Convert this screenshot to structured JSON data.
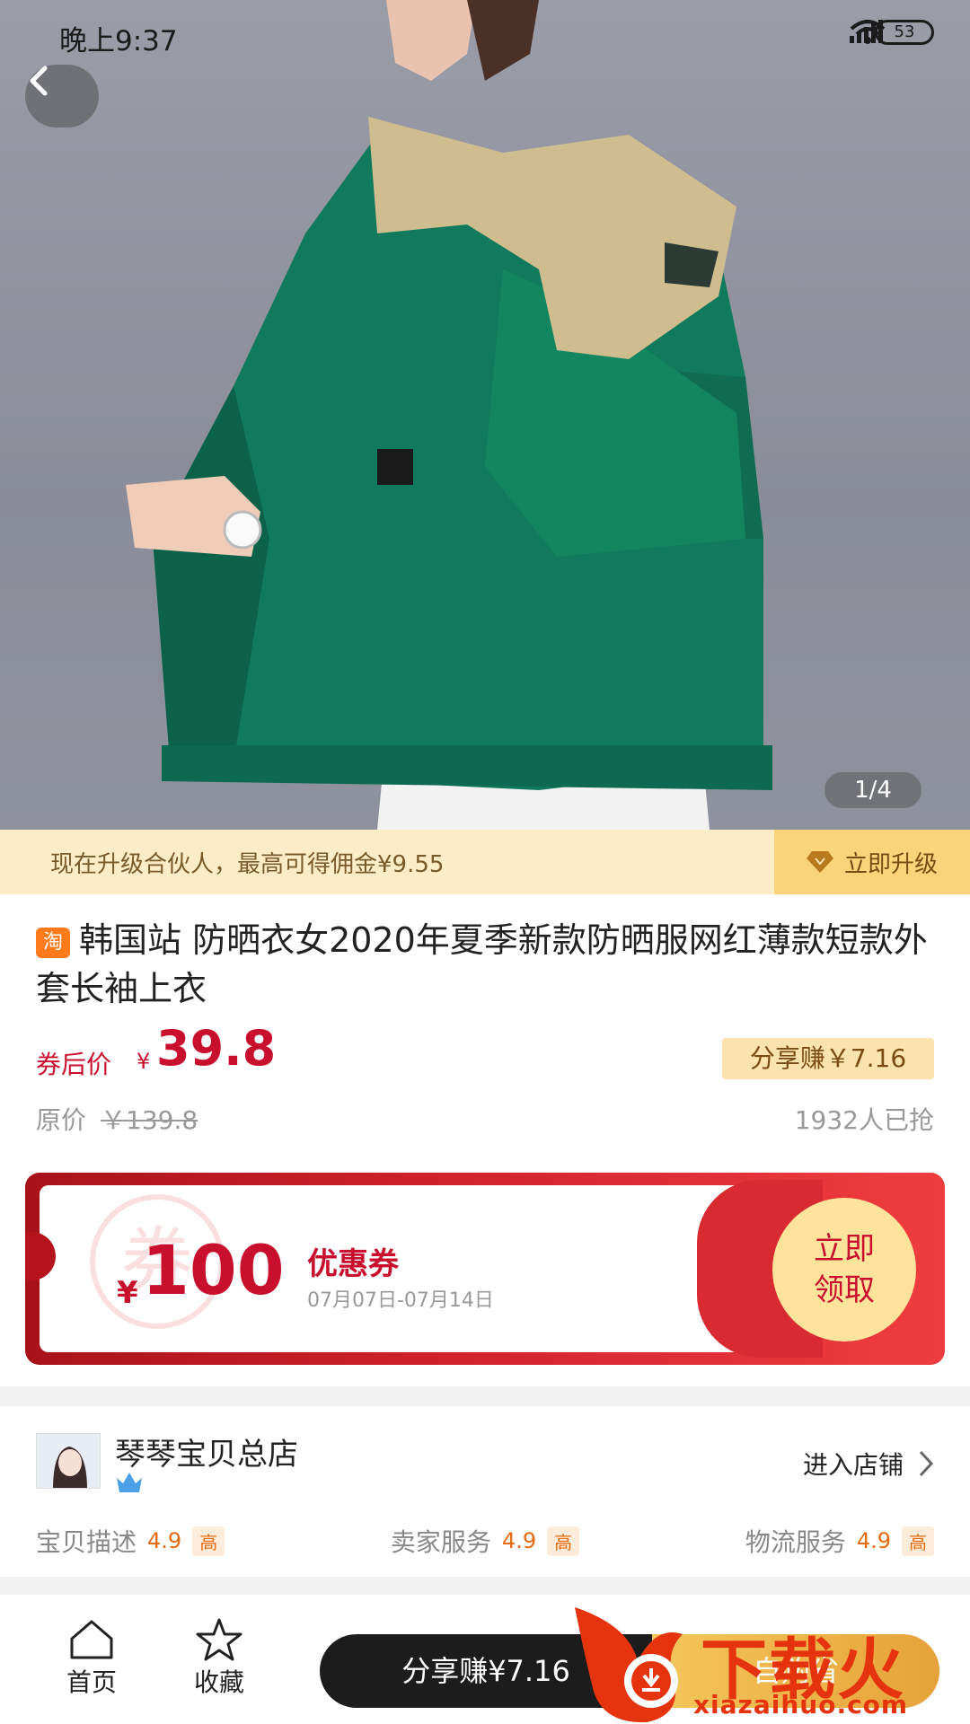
{
  "status_bar": {
    "time": "晚上9:37",
    "battery": "53"
  },
  "gallery": {
    "indicator": "1/4"
  },
  "upgrade_banner": {
    "message": "现在升级合伙人，最高可得佣金¥9.55",
    "action_label": "立即升级"
  },
  "product": {
    "platform_badge": "淘",
    "title": "韩国站 防晒衣女2020年夏季新款防晒服网红薄款短款外套长袖上衣",
    "price_label": "券后价",
    "price_currency": "¥",
    "price": "39.8",
    "share_earn": "分享赚￥7.16",
    "original_label": "原价",
    "original_price": "￥139.8",
    "sold": "1932人已抢"
  },
  "coupon": {
    "stamp_char": "券",
    "currency": "¥",
    "amount": "100",
    "name": "优惠券",
    "date_range": "07月07日-07月14日",
    "claim_line1": "立即",
    "claim_line2": "领取"
  },
  "store": {
    "name": "琴琴宝贝总店",
    "enter_label": "进入店铺",
    "ratings": [
      {
        "label": "宝贝描述",
        "score": "4.9",
        "level": "高"
      },
      {
        "label": "卖家服务",
        "score": "4.9",
        "level": "高"
      },
      {
        "label": "物流服务",
        "score": "4.9",
        "level": "高"
      }
    ]
  },
  "bottom_bar": {
    "home_label": "首页",
    "favorite_label": "收藏",
    "share_button": "分享赚¥7.16",
    "buy_button": "自购省"
  },
  "watermark": {
    "text": "下载火",
    "url": "xiazaihuo.com"
  },
  "colors": {
    "price_red": "#c8102e",
    "coupon_gold": "#fde49a",
    "banner_bg": "#fdecc8"
  },
  "icons": [
    "back-icon",
    "signal-icon",
    "wifi-icon",
    "diamond-icon",
    "crown-icon",
    "chevron-right-icon",
    "home-icon",
    "star-icon"
  ]
}
